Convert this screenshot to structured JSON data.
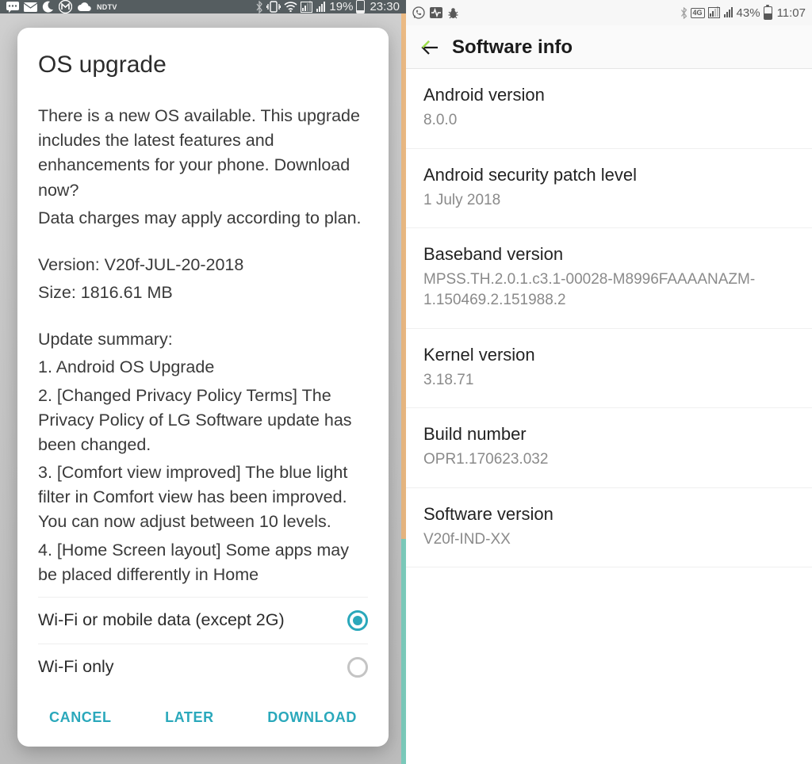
{
  "left": {
    "status": {
      "battery_pct": "19%",
      "time": "23:30",
      "icons_left": [
        "sms",
        "mail",
        "moon",
        "m-app",
        "cloud",
        "ndtv"
      ],
      "icons_right": [
        "bluetooth",
        "vibrate",
        "wifi",
        "signal1",
        "signal2",
        "battery"
      ]
    },
    "dialog": {
      "title": "OS upgrade",
      "para1": "There is a new OS available. This upgrade includes the latest features and enhancements for your phone. Download now?",
      "para2": "Data charges may apply according to plan.",
      "version_line": "Version: V20f-JUL-20-2018",
      "size_line": "Size: 1816.61 MB",
      "summary_header": "Update summary:",
      "summary_1": "1. Android OS Upgrade",
      "summary_2": "2. [Changed Privacy Policy Terms] The Privacy Policy of LG Software update has been changed.",
      "summary_3": "3. [Comfort view improved] The blue light filter in Comfort view has been improved. You can now adjust between 10 levels.",
      "summary_4": "4. [Home Screen layout] Some apps may be placed differently in Home",
      "radio_options": [
        {
          "label": "Wi-Fi or mobile data (except 2G)",
          "selected": true
        },
        {
          "label": "Wi-Fi only",
          "selected": false
        }
      ],
      "actions": {
        "cancel": "CANCEL",
        "later": "LATER",
        "download": "DOWNLOAD"
      }
    }
  },
  "right": {
    "status": {
      "battery_pct": "43%",
      "time": "11:07",
      "net_badge": "4G",
      "icons_left": [
        "whatsapp",
        "activity",
        "debug"
      ],
      "icons_right": [
        "bluetooth",
        "4g",
        "signal1",
        "signal2",
        "battery"
      ]
    },
    "header": {
      "title": "Software info"
    },
    "items": [
      {
        "label": "Android version",
        "value": "8.0.0"
      },
      {
        "label": "Android security patch level",
        "value": "1 July 2018"
      },
      {
        "label": "Baseband version",
        "value": "MPSS.TH.2.0.1.c3.1-00028-M8996FAAAANAZM-1.150469.2.151988.2"
      },
      {
        "label": "Kernel version",
        "value": "3.18.71"
      },
      {
        "label": "Build number",
        "value": "OPR1.170623.032"
      },
      {
        "label": "Software version",
        "value": "V20f-IND-XX"
      }
    ]
  }
}
